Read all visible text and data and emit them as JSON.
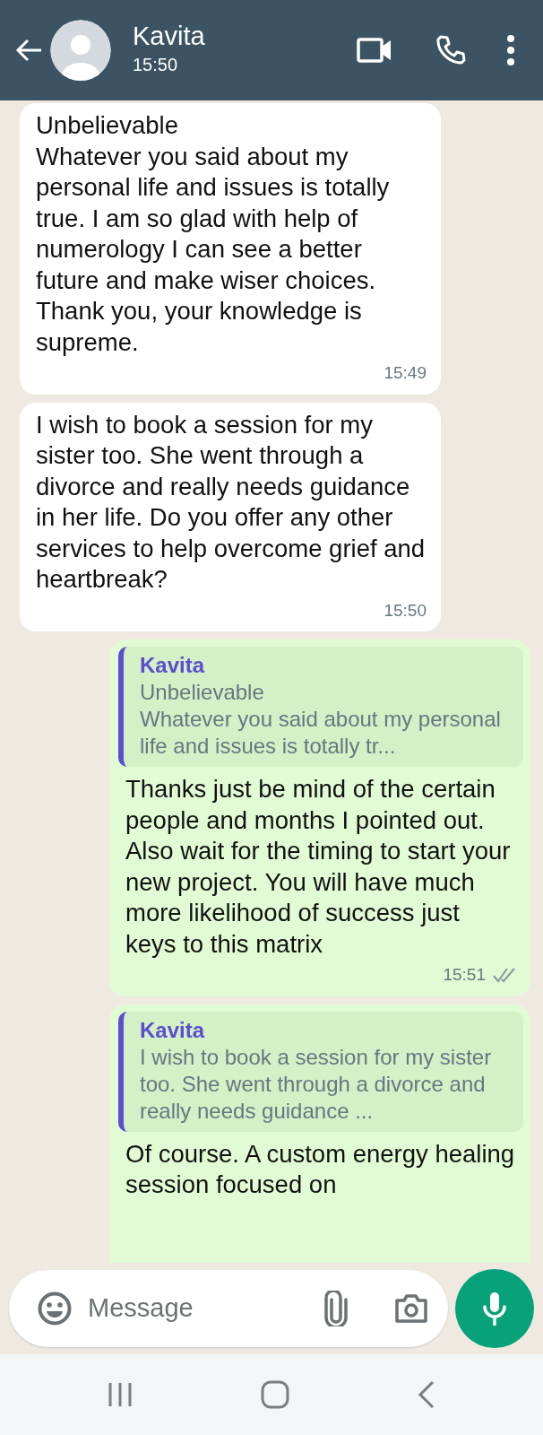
{
  "header": {
    "name": "Kavita",
    "status": "15:50"
  },
  "messages": [
    {
      "kind": "incoming",
      "text": "Unbelievable\nWhatever you said about my personal life and issues is totally true. I am so glad with help of numerology I can see a better future and make wiser choices. Thank you, your knowledge is supreme.",
      "time": "15:49"
    },
    {
      "kind": "incoming",
      "text": "I wish to book a session for my sister too. She went through a divorce and really needs guidance in her life. Do you offer any other services to help overcome grief and heartbreak?",
      "time": "15:50"
    },
    {
      "kind": "outgoing",
      "quote": {
        "author": "Kavita",
        "text": "Unbelievable\nWhatever you said about my personal life and issues is totally tr..."
      },
      "text": "Thanks just be mind of the certain people and months I pointed out. Also wait for the timing to start your new project. You will have much more likelihood of success just keys to this matrix",
      "time": "15:51",
      "read": false
    },
    {
      "kind": "outgoing",
      "quote": {
        "author": "Kavita",
        "text": "I wish to book a session for my sister too. She went through a divorce and really needs guidance ..."
      },
      "text": "Of course. A custom energy healing session focused on"
    }
  ],
  "composer": {
    "placeholder": "Message"
  }
}
